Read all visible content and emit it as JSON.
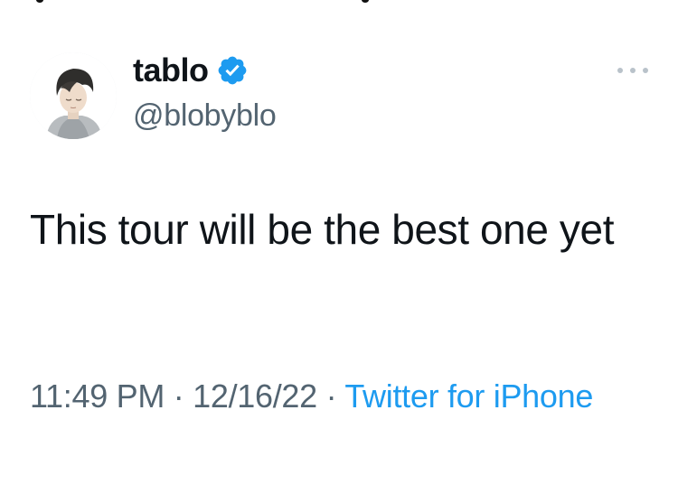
{
  "tweet": {
    "author": {
      "display_name": "tablo",
      "handle": "@blobyblo",
      "verified": true,
      "avatar_icon": "avatar-illustration-icon"
    },
    "menu_icon": "more-dots-icon",
    "text": "This tour will be the best one yet",
    "meta": {
      "time": "11:49 PM",
      "separator": "·",
      "date": "12/16/22",
      "source": "Twitter for iPhone"
    },
    "colors": {
      "link_blue": "#1d9bf0",
      "verified_blue": "#1d9bf0",
      "secondary_text": "#536471",
      "primary_text": "#0f1419"
    }
  }
}
